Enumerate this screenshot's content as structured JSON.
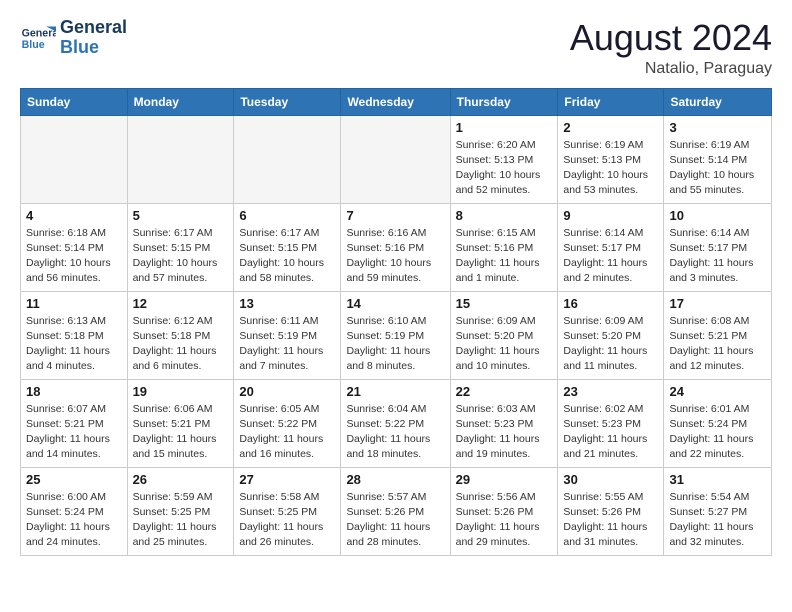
{
  "logo": {
    "text_general": "General",
    "text_blue": "Blue"
  },
  "header": {
    "month_year": "August 2024",
    "location": "Natalio, Paraguay"
  },
  "weekdays": [
    "Sunday",
    "Monday",
    "Tuesday",
    "Wednesday",
    "Thursday",
    "Friday",
    "Saturday"
  ],
  "weeks": [
    [
      {
        "day": "",
        "info": "",
        "empty": true
      },
      {
        "day": "",
        "info": "",
        "empty": true
      },
      {
        "day": "",
        "info": "",
        "empty": true
      },
      {
        "day": "",
        "info": "",
        "empty": true
      },
      {
        "day": "1",
        "info": "Sunrise: 6:20 AM\nSunset: 5:13 PM\nDaylight: 10 hours\nand 52 minutes."
      },
      {
        "day": "2",
        "info": "Sunrise: 6:19 AM\nSunset: 5:13 PM\nDaylight: 10 hours\nand 53 minutes."
      },
      {
        "day": "3",
        "info": "Sunrise: 6:19 AM\nSunset: 5:14 PM\nDaylight: 10 hours\nand 55 minutes."
      }
    ],
    [
      {
        "day": "4",
        "info": "Sunrise: 6:18 AM\nSunset: 5:14 PM\nDaylight: 10 hours\nand 56 minutes."
      },
      {
        "day": "5",
        "info": "Sunrise: 6:17 AM\nSunset: 5:15 PM\nDaylight: 10 hours\nand 57 minutes."
      },
      {
        "day": "6",
        "info": "Sunrise: 6:17 AM\nSunset: 5:15 PM\nDaylight: 10 hours\nand 58 minutes."
      },
      {
        "day": "7",
        "info": "Sunrise: 6:16 AM\nSunset: 5:16 PM\nDaylight: 10 hours\nand 59 minutes."
      },
      {
        "day": "8",
        "info": "Sunrise: 6:15 AM\nSunset: 5:16 PM\nDaylight: 11 hours\nand 1 minute."
      },
      {
        "day": "9",
        "info": "Sunrise: 6:14 AM\nSunset: 5:17 PM\nDaylight: 11 hours\nand 2 minutes."
      },
      {
        "day": "10",
        "info": "Sunrise: 6:14 AM\nSunset: 5:17 PM\nDaylight: 11 hours\nand 3 minutes."
      }
    ],
    [
      {
        "day": "11",
        "info": "Sunrise: 6:13 AM\nSunset: 5:18 PM\nDaylight: 11 hours\nand 4 minutes."
      },
      {
        "day": "12",
        "info": "Sunrise: 6:12 AM\nSunset: 5:18 PM\nDaylight: 11 hours\nand 6 minutes."
      },
      {
        "day": "13",
        "info": "Sunrise: 6:11 AM\nSunset: 5:19 PM\nDaylight: 11 hours\nand 7 minutes."
      },
      {
        "day": "14",
        "info": "Sunrise: 6:10 AM\nSunset: 5:19 PM\nDaylight: 11 hours\nand 8 minutes."
      },
      {
        "day": "15",
        "info": "Sunrise: 6:09 AM\nSunset: 5:20 PM\nDaylight: 11 hours\nand 10 minutes."
      },
      {
        "day": "16",
        "info": "Sunrise: 6:09 AM\nSunset: 5:20 PM\nDaylight: 11 hours\nand 11 minutes."
      },
      {
        "day": "17",
        "info": "Sunrise: 6:08 AM\nSunset: 5:21 PM\nDaylight: 11 hours\nand 12 minutes."
      }
    ],
    [
      {
        "day": "18",
        "info": "Sunrise: 6:07 AM\nSunset: 5:21 PM\nDaylight: 11 hours\nand 14 minutes."
      },
      {
        "day": "19",
        "info": "Sunrise: 6:06 AM\nSunset: 5:21 PM\nDaylight: 11 hours\nand 15 minutes."
      },
      {
        "day": "20",
        "info": "Sunrise: 6:05 AM\nSunset: 5:22 PM\nDaylight: 11 hours\nand 16 minutes."
      },
      {
        "day": "21",
        "info": "Sunrise: 6:04 AM\nSunset: 5:22 PM\nDaylight: 11 hours\nand 18 minutes."
      },
      {
        "day": "22",
        "info": "Sunrise: 6:03 AM\nSunset: 5:23 PM\nDaylight: 11 hours\nand 19 minutes."
      },
      {
        "day": "23",
        "info": "Sunrise: 6:02 AM\nSunset: 5:23 PM\nDaylight: 11 hours\nand 21 minutes."
      },
      {
        "day": "24",
        "info": "Sunrise: 6:01 AM\nSunset: 5:24 PM\nDaylight: 11 hours\nand 22 minutes."
      }
    ],
    [
      {
        "day": "25",
        "info": "Sunrise: 6:00 AM\nSunset: 5:24 PM\nDaylight: 11 hours\nand 24 minutes."
      },
      {
        "day": "26",
        "info": "Sunrise: 5:59 AM\nSunset: 5:25 PM\nDaylight: 11 hours\nand 25 minutes."
      },
      {
        "day": "27",
        "info": "Sunrise: 5:58 AM\nSunset: 5:25 PM\nDaylight: 11 hours\nand 26 minutes."
      },
      {
        "day": "28",
        "info": "Sunrise: 5:57 AM\nSunset: 5:26 PM\nDaylight: 11 hours\nand 28 minutes."
      },
      {
        "day": "29",
        "info": "Sunrise: 5:56 AM\nSunset: 5:26 PM\nDaylight: 11 hours\nand 29 minutes."
      },
      {
        "day": "30",
        "info": "Sunrise: 5:55 AM\nSunset: 5:26 PM\nDaylight: 11 hours\nand 31 minutes."
      },
      {
        "day": "31",
        "info": "Sunrise: 5:54 AM\nSunset: 5:27 PM\nDaylight: 11 hours\nand 32 minutes."
      }
    ]
  ]
}
